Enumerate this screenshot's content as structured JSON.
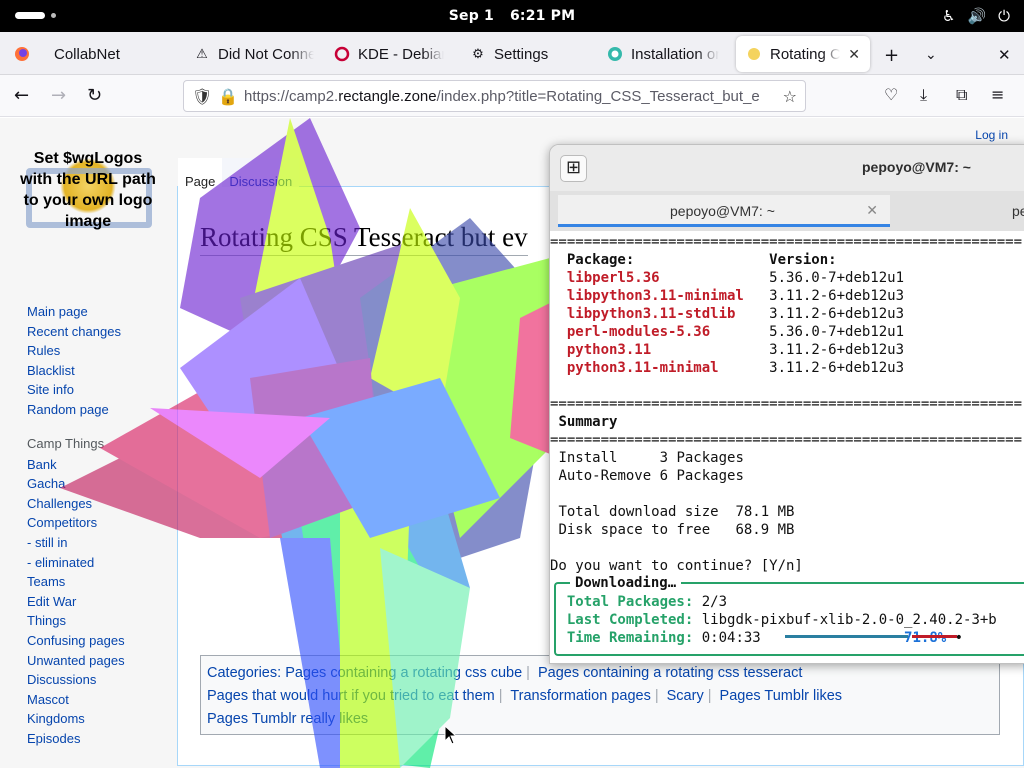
{
  "topbar": {
    "date": "Sep 1",
    "time": "6:21 PM"
  },
  "tabs": [
    {
      "label": "CollabNet",
      "icon": "firefox-icon"
    },
    {
      "label": "Did Not Conne",
      "icon": "warning-icon"
    },
    {
      "label": "KDE - Debian W",
      "icon": "debian-icon"
    },
    {
      "label": "Settings",
      "icon": "gear-icon"
    },
    {
      "label": "Installation on",
      "icon": "opensuse-icon"
    },
    {
      "label": "Rotating CSS",
      "icon": "sun-icon",
      "active": true
    }
  ],
  "url": {
    "prefix": "https://camp2.",
    "domain": "rectangle.zone",
    "path": "/index.php?title=Rotating_CSS_Tesseract_but_e"
  },
  "wiki": {
    "logo_text": "Set $wgLogos with the URL path to your own logo image",
    "login": "Log in",
    "tab_page": "Page",
    "tab_discussion": "Discussion",
    "title": "Rotating CSS Tesseract but ev",
    "nav": [
      "Main page",
      "Recent changes",
      "Rules",
      "Blacklist",
      "Site info",
      "Random page"
    ],
    "camp_header": "Camp Things",
    "camp": [
      "Bank",
      "Gacha",
      "Challenges",
      "Competitors",
      "- still in",
      "- eliminated",
      "Teams",
      "Edit War",
      "Things",
      "Confusing pages",
      "Unwanted pages",
      "Discussions",
      "Mascot",
      "Kingdoms",
      "Episodes"
    ],
    "categories_label": "Categories:",
    "categories": [
      "Pages containing a rotating css cube",
      "Pages containing a rotating css tesseract",
      "Pages that would hurt if you tried to eat them",
      "Transformation pages",
      "Scary",
      "Pages Tumblr likes",
      "Pages Tumblr really likes"
    ]
  },
  "terminal": {
    "title": "pepoyo@VM7: ~",
    "tab1": "pepoyo@VM7: ~",
    "tab2": "pe",
    "pkg_header": "Package:",
    "ver_header": "Version:",
    "packages": [
      {
        "name": "libperl5.36",
        "version": "5.36.0-7+deb12u1"
      },
      {
        "name": "libpython3.11-minimal",
        "version": "3.11.2-6+deb12u3"
      },
      {
        "name": "libpython3.11-stdlib",
        "version": "3.11.2-6+deb12u3"
      },
      {
        "name": "perl-modules-5.36",
        "version": "5.36.0-7+deb12u1"
      },
      {
        "name": "python3.11",
        "version": "3.11.2-6+deb12u3"
      },
      {
        "name": "python3.11-minimal",
        "version": "3.11.2-6+deb12u3"
      }
    ],
    "summary": "Summary",
    "install": "Install     3 Packages",
    "autoremove": "Auto-Remove 6 Packages",
    "download": "Total download size  78.1 MB",
    "disk": "Disk space to free   68.9 MB",
    "prompt": "Do you want to continue? [Y/n]",
    "dl_title": "Downloading…",
    "total_label": "Total Packages:",
    "total_val": "2/3",
    "last_label": "Last Completed:",
    "last_val": "libgdk-pixbuf-xlib-2.0-0_2.40.2-3+b",
    "time_label": "Time Remaining:",
    "time_val": "0:04:33",
    "percent": "71.8%",
    "progress": 0.718
  }
}
